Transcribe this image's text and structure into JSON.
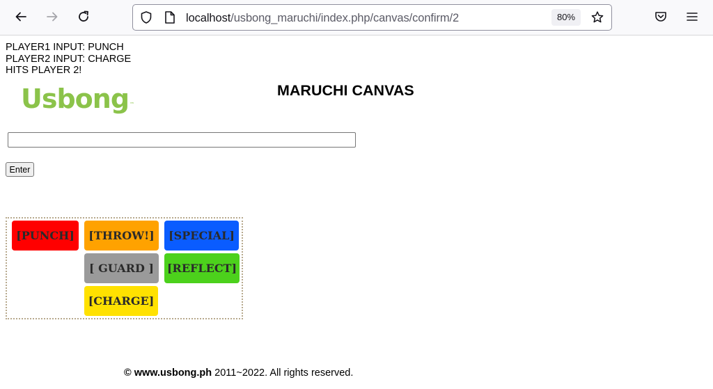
{
  "browser": {
    "url_host": "localhost",
    "url_path": "/usbong_maruchi/index.php/canvas/confirm/2",
    "zoom": "80%",
    "icons": [
      "back-arrow-icon",
      "forward-arrow-icon",
      "reload-icon",
      "shield-icon",
      "page-icon",
      "star-icon",
      "pocket-icon",
      "hamburger-menu-icon"
    ]
  },
  "status": {
    "player1": "PLAYER1 INPUT: PUNCH",
    "player2": "PLAYER2 INPUT: CHARGE",
    "result": "HITS PLAYER 2!"
  },
  "logo": {
    "text": "Usbong",
    "tm": "™"
  },
  "page_title": "MARUCHI CANVAS",
  "input": {
    "value": "",
    "placeholder": ""
  },
  "enter_label": "Enter",
  "commands": {
    "punch": {
      "label": "[PUNCH]",
      "color": "#ff0000"
    },
    "throw": {
      "label": "[THROW!]",
      "color": "#ffa200"
    },
    "special": {
      "label": "[SPECIAL]",
      "color": "#0a5cff"
    },
    "guard": {
      "label": "[ GUARD ]",
      "color": "#9a9a9a"
    },
    "reflect": {
      "label": "[REFLECT]",
      "color": "#4cd11c"
    },
    "charge": {
      "label": "[CHARGE]",
      "color": "#ffe100"
    }
  },
  "footer": {
    "site": "© www.usbong.ph",
    "rest": " 2011~2022. All rights reserved."
  }
}
